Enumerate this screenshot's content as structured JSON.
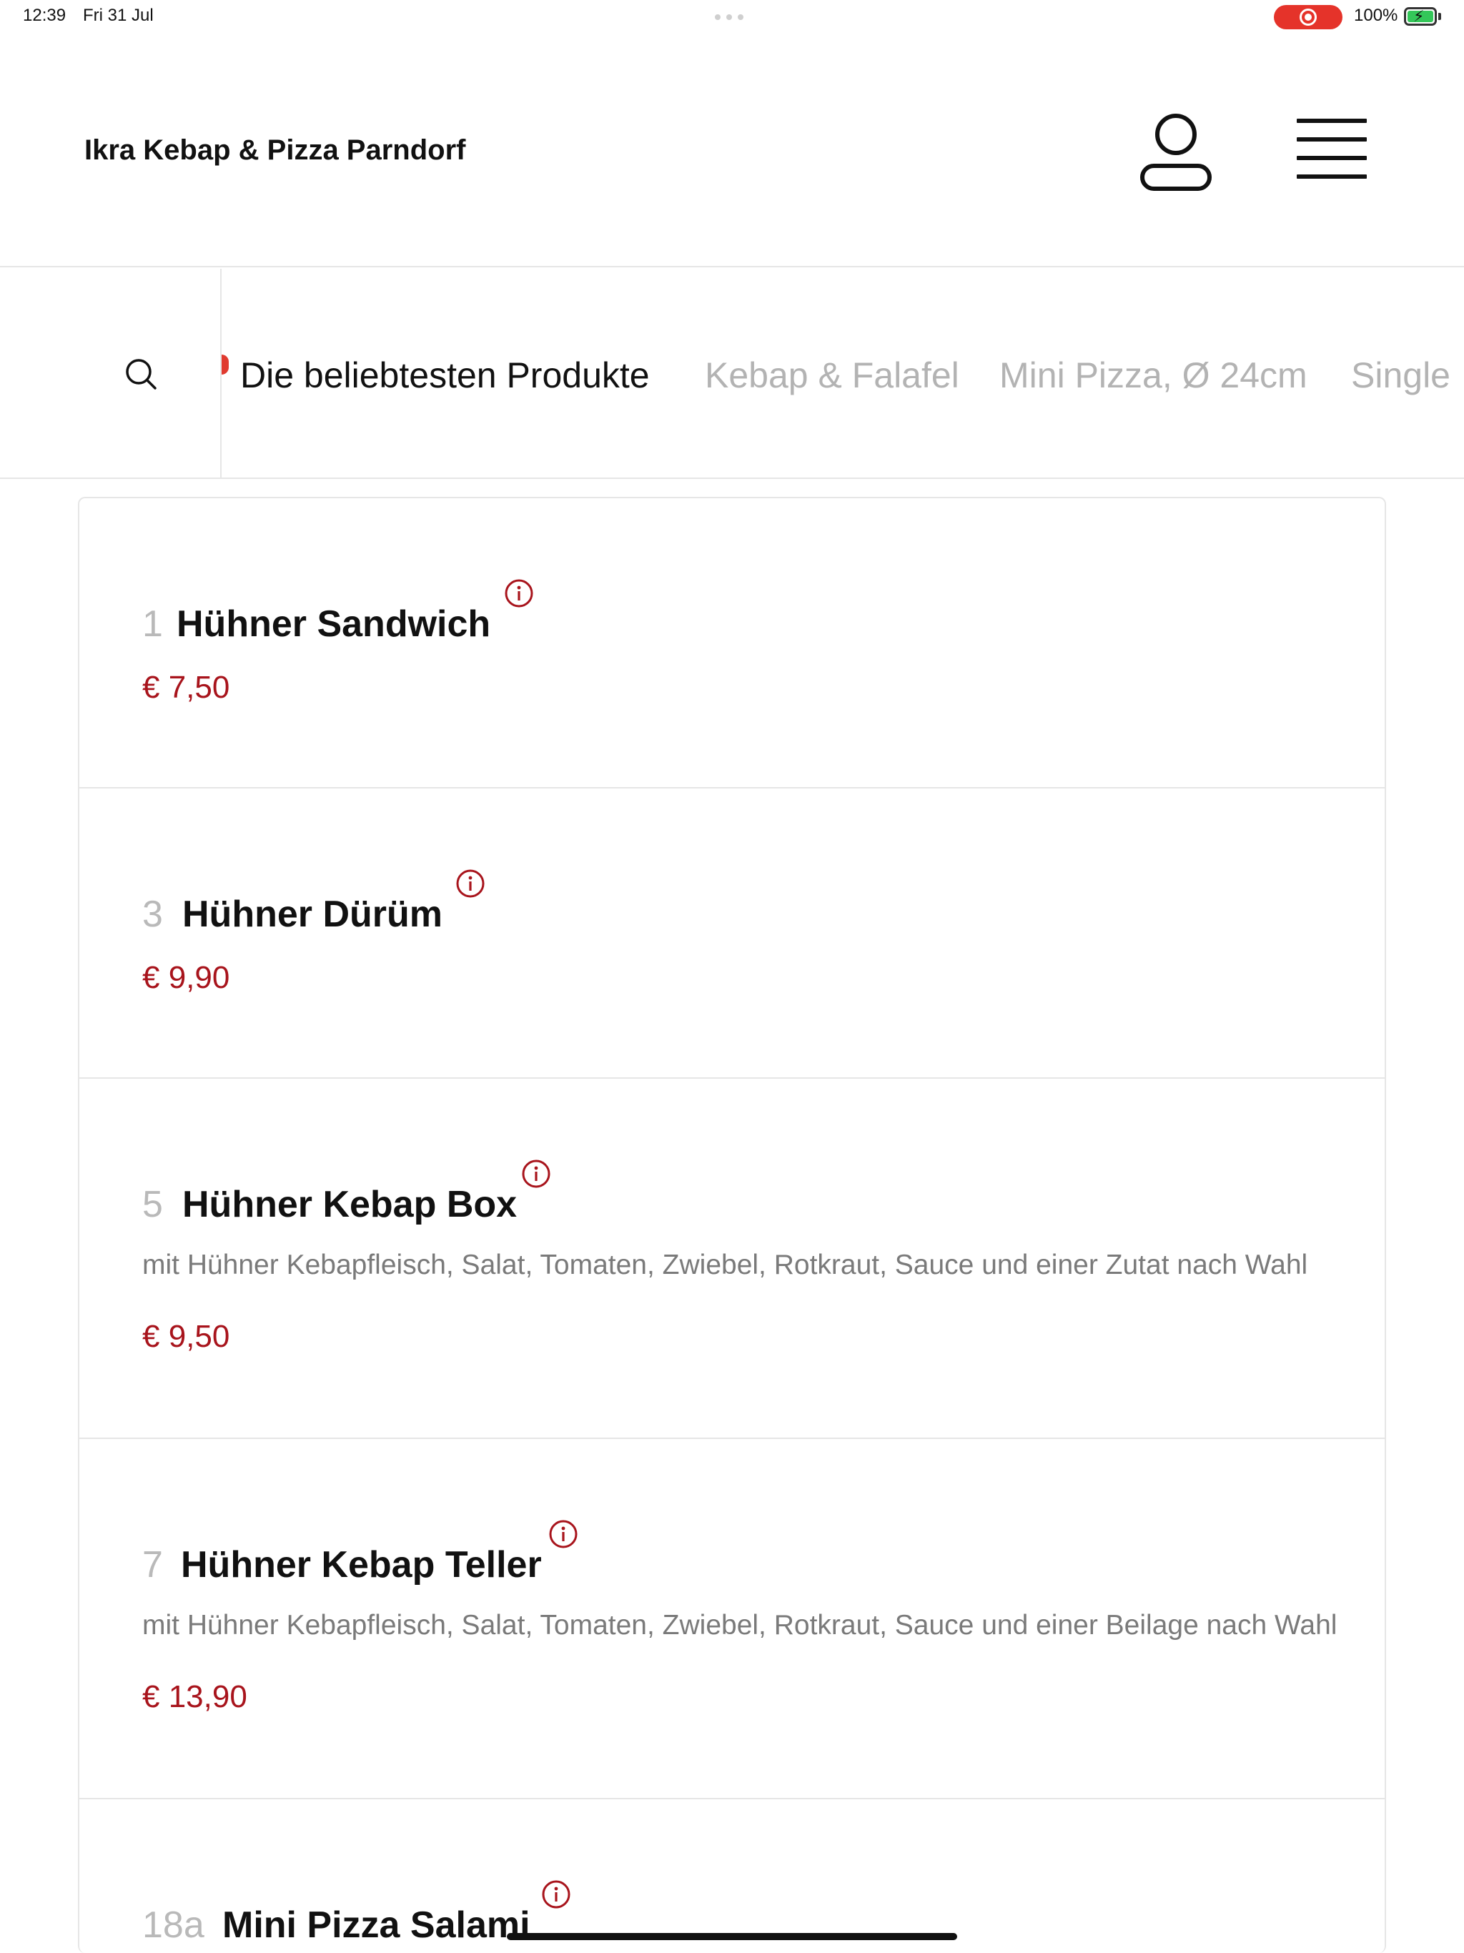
{
  "status_bar": {
    "time": "12:39",
    "date": "Fri 31 Jul",
    "battery": "100%"
  },
  "header": {
    "restaurant_name": "Ikra Kebap & Pizza Parndorf",
    "account_icon": "person-icon",
    "menu_icon": "hamburger-icon"
  },
  "categories": [
    {
      "label": "Die beliebtesten Produkte",
      "active": true
    },
    {
      "label": "Kebap & Falafel",
      "active": false
    },
    {
      "label": "Mini Pizza, Ø 24cm",
      "active": false
    },
    {
      "label": "Single",
      "active": false
    }
  ],
  "items": [
    {
      "number": "1",
      "name": "Hühner Sandwich",
      "description": "",
      "price": "€ 7,50"
    },
    {
      "number": "3",
      "name": "Hühner Dürüm",
      "description": "",
      "price": "€ 9,90"
    },
    {
      "number": "5",
      "name": "Hühner Kebap Box",
      "description": "mit Hühner Kebapfleisch, Salat, Tomaten, Zwiebel, Rotkraut, Sauce und einer Zutat nach Wahl",
      "price": "€ 9,50"
    },
    {
      "number": "7",
      "name": "Hühner Kebap Teller",
      "description": "mit Hühner Kebapfleisch, Salat, Tomaten, Zwiebel, Rotkraut, Sauce und einer Beilage nach Wahl",
      "price": "€ 13,90"
    },
    {
      "number": "18a",
      "name": "Mini Pizza Salami",
      "description": "",
      "price": ""
    }
  ],
  "colors": {
    "price": "#a8141c",
    "accent": "#a8141c",
    "inactive_tab": "#b3b3b3",
    "record_indicator": "#e5332a",
    "battery_fill": "#34c759"
  }
}
